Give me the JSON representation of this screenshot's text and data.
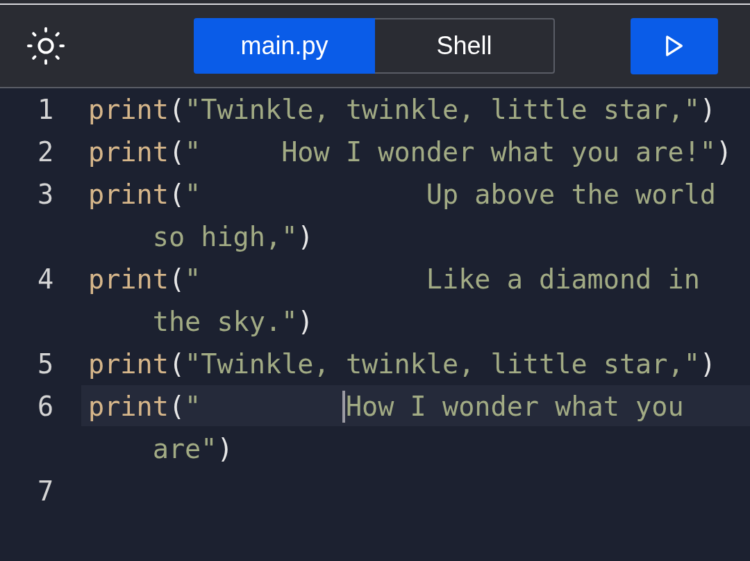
{
  "toolbar": {
    "tabs": [
      {
        "label": "main.py",
        "selected": true
      },
      {
        "label": "Shell",
        "selected": false
      }
    ]
  },
  "editor": {
    "lines": [
      {
        "number": "1",
        "active": false,
        "tokens": [
          {
            "kind": "function",
            "text": "print"
          },
          {
            "kind": "punct",
            "text": "("
          },
          {
            "kind": "string",
            "text": "\"Twinkle, twinkle, little star,\""
          },
          {
            "kind": "punct",
            "text": ")"
          }
        ]
      },
      {
        "number": "2",
        "active": false,
        "tokens": [
          {
            "kind": "function",
            "text": "print"
          },
          {
            "kind": "punct",
            "text": "("
          },
          {
            "kind": "string",
            "text": "\"     How I wonder what you are!\""
          },
          {
            "kind": "punct",
            "text": ")"
          }
        ]
      },
      {
        "number": "3",
        "active": false,
        "tokens": [
          {
            "kind": "function",
            "text": "print"
          },
          {
            "kind": "punct",
            "text": "("
          },
          {
            "kind": "string",
            "text": "\"              Up above the world so high,\""
          },
          {
            "kind": "punct",
            "text": ")"
          }
        ]
      },
      {
        "number": "4",
        "active": false,
        "tokens": [
          {
            "kind": "function",
            "text": "print"
          },
          {
            "kind": "punct",
            "text": "("
          },
          {
            "kind": "string",
            "text": "\"              Like a diamond in the sky.\""
          },
          {
            "kind": "punct",
            "text": ")"
          }
        ]
      },
      {
        "number": "5",
        "active": false,
        "tokens": [
          {
            "kind": "function",
            "text": "print"
          },
          {
            "kind": "punct",
            "text": "("
          },
          {
            "kind": "string",
            "text": "\"Twinkle, twinkle, little star,\""
          },
          {
            "kind": "punct",
            "text": ")"
          }
        ]
      },
      {
        "number": "6",
        "active": true,
        "tokens": [
          {
            "kind": "function",
            "text": "print"
          },
          {
            "kind": "punct",
            "text": "("
          },
          {
            "kind": "string",
            "text": "\"         "
          },
          {
            "kind": "cursor"
          },
          {
            "kind": "string",
            "text": "How I wonder what you are\""
          },
          {
            "kind": "punct",
            "text": ")"
          }
        ]
      },
      {
        "number": "7",
        "active": false
      }
    ]
  }
}
